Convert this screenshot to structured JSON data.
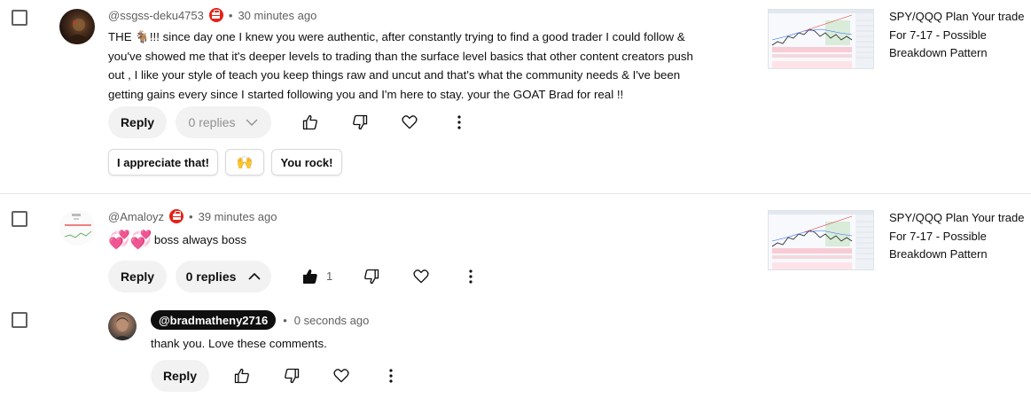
{
  "comments": [
    {
      "handle": "@ssgss-deku4753",
      "separator": "•",
      "time": "30 minutes ago",
      "text_lines": [
        "THE 🐐!!!  since day one I knew you were authentic, after constantly trying to find a good trader I could follow &",
        "you've showed me that it's deeper levels to trading than the surface level basics that other content creators push",
        "out  , I like your style of teach you keep things raw and uncut and that's what the community needs & I've been",
        "getting gains every since I started following you and I'm here to stay. your the GOAT Brad for real !!"
      ],
      "reply_label": "Reply",
      "replies_label": "0 replies",
      "quick_replies": [
        "I appreciate that!",
        "🙌",
        "You rock!"
      ],
      "video_title": "SPY/QQQ Plan Your trade For 7-17 - Possible Breakdown Pattern"
    },
    {
      "handle": "@Amaloyz",
      "separator": "•",
      "time": "39 minutes ago",
      "emoji": "💞💞",
      "text": "boss always boss",
      "reply_label": "Reply",
      "replies_label": "0 replies",
      "like_count": "1",
      "video_title": "SPY/QQQ Plan Your trade For 7-17 - Possible Breakdown Pattern"
    }
  ],
  "reply": {
    "handle": "@bradmatheny2716",
    "separator": "•",
    "time": "0 seconds ago",
    "text": "thank you. Love these comments.",
    "reply_label": "Reply"
  },
  "colors": {
    "text_primary": "#0f0f0f",
    "text_secondary": "#606060",
    "member_badge": "#e62117",
    "pill_bg": "#f2f2f2",
    "channel_pill_bg": "#0f0f0f"
  },
  "icons": [
    "checkbox-icon",
    "member-badge-icon",
    "thumbs-up-icon",
    "thumbs-down-icon",
    "heart-icon",
    "more-vert-icon",
    "chevron-down-icon",
    "chevron-up-icon"
  ]
}
